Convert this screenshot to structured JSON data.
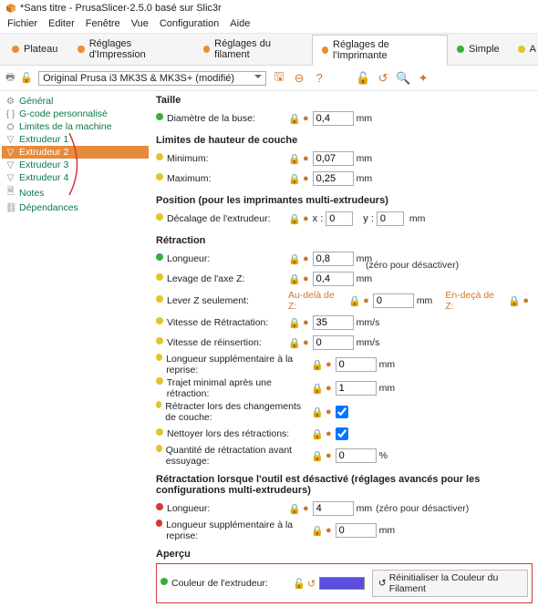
{
  "title": "*Sans titre - PrusaSlicer-2.5.0 basé sur Slic3r",
  "menu": [
    "Fichier",
    "Editer",
    "Fenêtre",
    "Vue",
    "Configuration",
    "Aide"
  ],
  "tabs": {
    "plateau": "Plateau",
    "impr": "Réglages d'Impression",
    "fil": "Réglages du filament",
    "printer": "Réglages de l'Imprimante",
    "simple": "Simple",
    "a": "A"
  },
  "preset": "Original Prusa i3 MK3S & MK3S+ (modifié)",
  "sidebar": {
    "items": [
      {
        "label": "Général",
        "icon": "⚙"
      },
      {
        "label": "G-code personnalisé",
        "icon": "{ }"
      },
      {
        "label": "Limites de la machine",
        "icon": "⛭"
      },
      {
        "label": "Extrudeur 1",
        "icon": "▽"
      },
      {
        "label": "Extrudeur 2",
        "icon": "▽"
      },
      {
        "label": "Extrudeur 3",
        "icon": "▽"
      },
      {
        "label": "Extrudeur 4",
        "icon": "▽"
      },
      {
        "label": "Notes",
        "icon": "🗎"
      },
      {
        "label": "Dépendances",
        "icon": "⛓"
      }
    ]
  },
  "sections": {
    "size": {
      "title": "Taille",
      "nozzle": {
        "label": "Diamètre de la buse:",
        "value": "0,4",
        "unit": "mm"
      }
    },
    "layer": {
      "title": "Limites de hauteur de couche",
      "min": {
        "label": "Minimum:",
        "value": "0,07",
        "unit": "mm"
      },
      "max": {
        "label": "Maximum:",
        "value": "0,25",
        "unit": "mm"
      }
    },
    "pos": {
      "title": "Position (pour les imprimantes multi-extrudeurs)",
      "offset": {
        "label": "Décalage de l'extrudeur:",
        "x": "x :",
        "y": "y :",
        "xv": "0",
        "yv": "0",
        "unit": "mm"
      }
    },
    "retr": {
      "title": "Rétraction",
      "len": {
        "label": "Longueur:",
        "value": "0,8",
        "unit": "mm",
        "hint": "(zéro pour désactiver)"
      },
      "zlift": {
        "label": "Levage de l'axe Z:",
        "value": "0,4",
        "unit": "mm"
      },
      "zonly": {
        "label": "Lever Z seulement:",
        "above": "Au-delà de Z:",
        "below": "En-deçà de Z:",
        "v1": "0",
        "unit": "mm"
      },
      "rspeed": {
        "label": "Vitesse de Rétractation:",
        "value": "35",
        "unit": "mm/s"
      },
      "dspeed": {
        "label": "Vitesse de réinsertion:",
        "value": "0",
        "unit": "mm/s"
      },
      "extra": {
        "label": "Longueur supplémentaire à la reprise:",
        "value": "0",
        "unit": "mm"
      },
      "min": {
        "label": "Trajet minimal après une rétraction:",
        "value": "1",
        "unit": "mm"
      },
      "layer": {
        "label": "Rétracter lors des changements de couche:"
      },
      "wipe": {
        "label": "Nettoyer lors des rétractions:"
      },
      "wipeamt": {
        "label": "Quantité de rétractation avant essuyage:",
        "value": "0",
        "unit": "%"
      }
    },
    "disabled": {
      "title": "Rétractation lorsque l'outil est désactivé (réglages avancés pour les configurations multi-extrudeurs)",
      "len": {
        "label": "Longueur:",
        "value": "4",
        "unit": "mm",
        "hint": "(zéro pour désactiver)"
      },
      "extra": {
        "label": "Longueur supplémentaire à la reprise:",
        "value": "0",
        "unit": "mm"
      }
    },
    "preview": {
      "title": "Aperçu",
      "color": {
        "label": "Couleur de l'extrudeur:",
        "reset": "Réinitialiser la Couleur du Filament"
      }
    }
  }
}
